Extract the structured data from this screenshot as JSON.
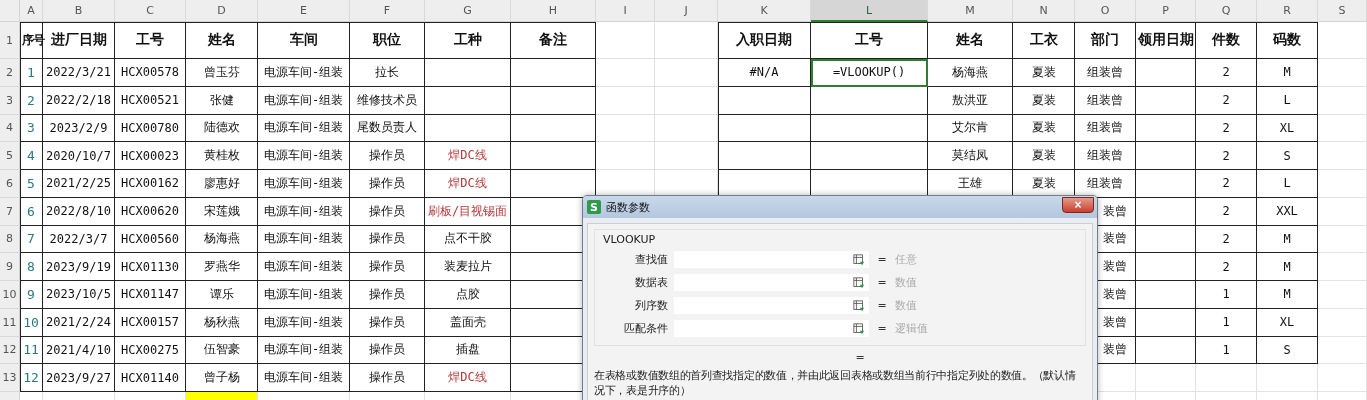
{
  "column_headers": [
    {
      "label": "A",
      "selected": false
    },
    {
      "label": "B",
      "selected": false
    },
    {
      "label": "C",
      "selected": false
    },
    {
      "label": "D",
      "selected": false
    },
    {
      "label": "E",
      "selected": false
    },
    {
      "label": "F",
      "selected": false
    },
    {
      "label": "G",
      "selected": false
    },
    {
      "label": "H",
      "selected": false
    },
    {
      "label": "I",
      "selected": false
    },
    {
      "label": "J",
      "selected": false
    },
    {
      "label": "K",
      "selected": false
    },
    {
      "label": "L",
      "selected": true
    },
    {
      "label": "M",
      "selected": false
    },
    {
      "label": "N",
      "selected": false
    },
    {
      "label": "O",
      "selected": false
    },
    {
      "label": "P",
      "selected": false
    },
    {
      "label": "Q",
      "selected": false
    },
    {
      "label": "R",
      "selected": false
    },
    {
      "label": "S",
      "selected": false
    }
  ],
  "rows": [
    {
      "number": "1",
      "cells": [
        "序号",
        "进厂日期",
        "工号",
        "姓名",
        "车间",
        "职位",
        "工种",
        "备注",
        null,
        null,
        "入职日期",
        "工号",
        "姓名",
        "工衣",
        "部门",
        "领用日期",
        "件数",
        "码数",
        null
      ]
    },
    {
      "number": "2",
      "cells": [
        "1",
        "2022/3/21",
        "HCX00578",
        "曾玉芬",
        "电源车间-组装",
        "拉长",
        null,
        null,
        null,
        null,
        "#N/A",
        {
          "text": "=VLOOKUP()",
          "selected": true
        },
        "杨海燕",
        "夏装",
        "组装曾",
        null,
        "2",
        "M",
        null
      ]
    },
    {
      "number": "3",
      "cells": [
        "2",
        "2022/2/18",
        "HCX00521",
        "张健",
        "电源车间-组装",
        "维修技术员",
        null,
        null,
        null,
        null,
        null,
        null,
        "敖洪亚",
        "夏装",
        "组装曾",
        null,
        "2",
        "L",
        null
      ]
    },
    {
      "number": "4",
      "cells": [
        "3",
        "2023/2/9",
        "HCX00780",
        "陆德欢",
        "电源车间-组装",
        "尾数员责人",
        null,
        null,
        null,
        null,
        null,
        null,
        "艾尔肯",
        "夏装",
        "组装曾",
        null,
        "2",
        "XL",
        null
      ]
    },
    {
      "number": "5",
      "cells": [
        "4",
        "2020/10/7",
        "HCX00023",
        "黄桂枚",
        "电源车间-组装",
        "操作员",
        {
          "text": "焊DC线",
          "color": "#b23a3a"
        },
        null,
        null,
        null,
        null,
        null,
        "莫结凤",
        "夏装",
        "组装曾",
        null,
        "2",
        "S",
        null
      ]
    },
    {
      "number": "6",
      "cells": [
        "5",
        "2021/2/25",
        "HCX00162",
        "廖惠好",
        "电源车间-组装",
        "操作员",
        {
          "text": "焊DC线",
          "color": "#b23a3a"
        },
        null,
        null,
        null,
        null,
        null,
        "王雄",
        "夏装",
        "组装曾",
        null,
        "2",
        "L",
        null
      ]
    },
    {
      "number": "7",
      "cells": [
        "6",
        "2022/8/10",
        "HCX00620",
        "宋莲娥",
        "电源车间-组装",
        "操作员",
        {
          "text": "刷板/目视锡面",
          "color": "#b23a3a"
        },
        null,
        null,
        null,
        null,
        null,
        null,
        null,
        "装曾",
        null,
        "2",
        "XXL",
        null
      ]
    },
    {
      "number": "8",
      "cells": [
        "7",
        "2022/3/7",
        "HCX00560",
        "杨海燕",
        "电源车间-组装",
        "操作员",
        "点不干胶",
        null,
        null,
        null,
        null,
        null,
        null,
        null,
        "装曾",
        null,
        "2",
        "M",
        null
      ]
    },
    {
      "number": "9",
      "cells": [
        "8",
        "2023/9/19",
        "HCX01130",
        "罗燕华",
        "电源车间-组装",
        "操作员",
        "装麦拉片",
        null,
        null,
        null,
        null,
        null,
        null,
        null,
        "装曾",
        null,
        "2",
        "M",
        null
      ]
    },
    {
      "number": "10",
      "cells": [
        "9",
        "2023/10/5",
        "HCX01147",
        "谭乐",
        "电源车间-组装",
        "操作员",
        "点胶",
        null,
        null,
        null,
        null,
        null,
        null,
        null,
        "装曾",
        null,
        "1",
        "M",
        null
      ]
    },
    {
      "number": "11",
      "cells": [
        "10",
        "2021/2/24",
        "HCX00157",
        "杨秋燕",
        "电源车间-组装",
        "操作员",
        "盖面壳",
        null,
        null,
        null,
        null,
        null,
        null,
        null,
        "装曾",
        null,
        "1",
        "XL",
        null
      ]
    },
    {
      "number": "12",
      "cells": [
        "11",
        "2021/4/10",
        "HCX00275",
        "伍智豪",
        "电源车间-组装",
        "操作员",
        "插盘",
        null,
        null,
        null,
        null,
        null,
        null,
        null,
        "装曾",
        null,
        "1",
        "S",
        null
      ]
    },
    {
      "number": "13",
      "cells": [
        "12",
        "2023/9/27",
        "HCX01140",
        "曾子杨",
        "电源车间-组装",
        "操作员",
        {
          "text": "焊DC线",
          "color": "#b23a3a"
        },
        null,
        null,
        null,
        null,
        null,
        null,
        null,
        null,
        null,
        null,
        null,
        null
      ]
    },
    {
      "cells": [
        null,
        null,
        null,
        {
          "text": null,
          "color": "#ffff00"
        },
        null,
        null,
        null,
        null,
        null,
        null,
        null,
        null,
        null,
        null,
        null,
        null,
        null,
        null,
        null
      ]
    }
  ],
  "dialog": {
    "app_icon": "S",
    "title": "函数参数",
    "close": "×",
    "function_name": "VLOOKUP",
    "arguments": [
      {
        "label": "查找值",
        "hint": "任意"
      },
      {
        "label": "数据表",
        "hint": "数值"
      },
      {
        "label": "列序数",
        "hint": "数值"
      },
      {
        "label": "匹配条件",
        "hint": "逻辑值"
      }
    ],
    "equals": "=",
    "result": "=",
    "description": "在表格或数值数组的首列查找指定的数值，并由此返回表格或数组当前行中指定列处的数值。（默认情况下，表是升序的）"
  }
}
